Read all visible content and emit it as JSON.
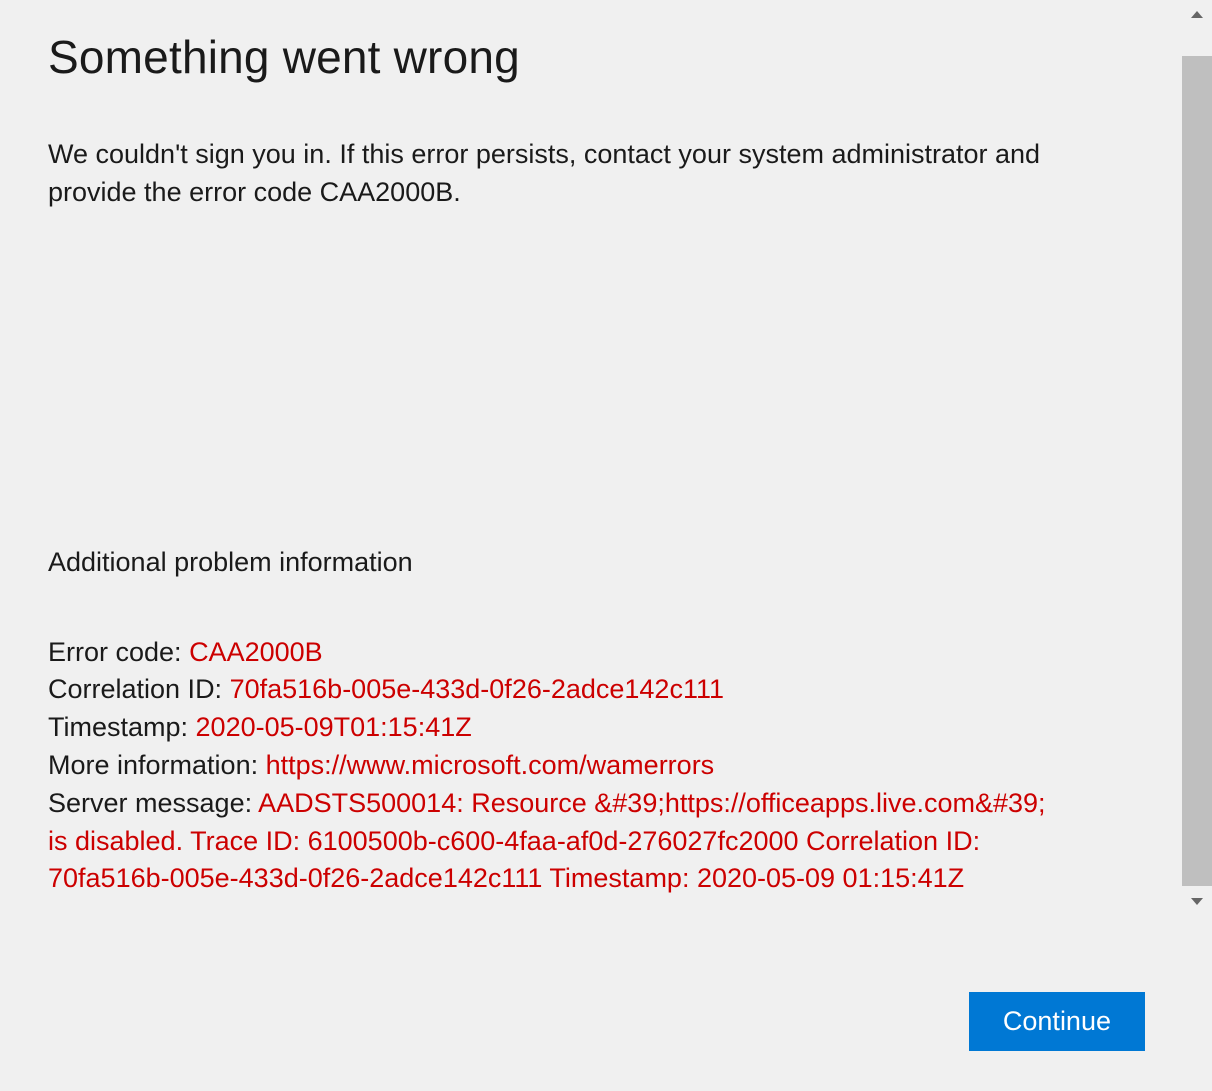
{
  "dialog": {
    "title": "Something went wrong",
    "description": "We couldn't sign you in. If this error persists, contact your system administrator and provide the error code CAA2000B.",
    "sectionTitle": "Additional problem information",
    "errorCode": {
      "label": "Error code: ",
      "value": "CAA2000B"
    },
    "correlationId": {
      "label": "Correlation ID: ",
      "value": "70fa516b-005e-433d-0f26-2adce142c111"
    },
    "timestamp": {
      "label": "Timestamp: ",
      "value": "2020-05-09T01:15:41Z"
    },
    "moreInfo": {
      "label": "More information: ",
      "value": "https://www.microsoft.com/wamerrors"
    },
    "serverMessage": {
      "label": "Server message: ",
      "valueLine1": "AADSTS500014: Resource &#39;https://officeapps.live.com&#39; is disabled. Trace ID: 6100500b-c600-4faa-af0d-276027fc2000 Correlation ID: 70fa516b-005e-433d-0f26-2adce142c111 Timestamp: 2020-05-09 01:15:41Z"
    },
    "continueLabel": "Continue"
  }
}
